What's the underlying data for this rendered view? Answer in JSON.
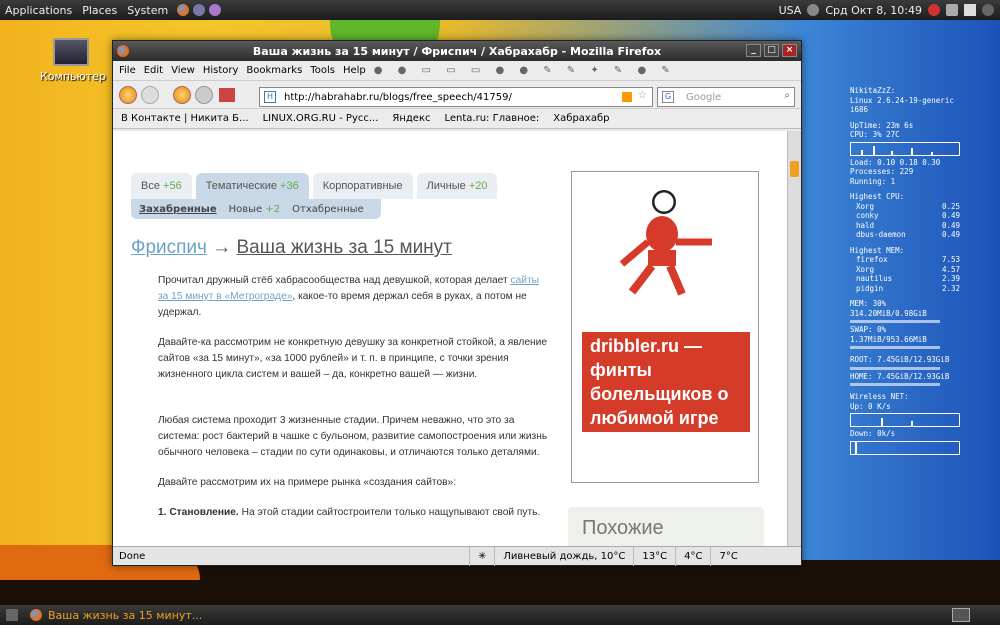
{
  "topbar": {
    "menus": [
      "Applications",
      "Places",
      "System"
    ],
    "tray": {
      "kbd": "USA",
      "datetime": "Срд Окт  8, 10:49"
    }
  },
  "desktop": {
    "icon_label": "Компьютер"
  },
  "conky": {
    "host": "NikitaZzZ:",
    "kernel": "Linux 2.6.24-19-generic",
    "arch": "i686",
    "uptime": "UpTime: 23m 6s",
    "cpu": "CPU: 3% 27C",
    "load": "Load: 0.10 0.18 0.30",
    "processes": "Processes: 229",
    "running": "Running: 1",
    "highest_cpu_title": "Highest CPU:",
    "top_cpu": [
      [
        "Xorg",
        "0.25"
      ],
      [
        "conky",
        "0.49"
      ],
      [
        "hald",
        "0.49"
      ],
      [
        "dbus-daemon",
        "0.49"
      ]
    ],
    "highest_mem_title": "Highest MEM:",
    "top_mem": [
      [
        "firefox",
        "7.53"
      ],
      [
        "Xorg",
        "4.57"
      ],
      [
        "nautilus",
        "2.39"
      ],
      [
        "pidgin",
        "2.32"
      ]
    ],
    "mem": "MEM: 30% 314.20MiB/0.98GiB",
    "swap": "SWAP: 0% 1.37MiB/953.66MiB",
    "root": "ROOT: 7.45GiB/12.93GiB",
    "home": "HOME: 7.45GiB/12.93GiB",
    "net_title": "Wireless NET:",
    "up": "Up: 0 K/s",
    "down": "Down: 0k/s"
  },
  "window": {
    "title": "Ваша жизнь за 15 минут / Фриспич / Хабрахабр - Mozilla Firefox",
    "menu": [
      "File",
      "Edit",
      "View",
      "History",
      "Bookmarks",
      "Tools",
      "Help"
    ],
    "url": "http://habrahabr.ru/blogs/free_speech/41759/",
    "search_placeholder": "Google",
    "bookmarks": [
      "В Контакте | Никита Б...",
      "LINUX.ORG.RU - Русс...",
      "Яндекс",
      "Lenta.ru: Главное:",
      "Хабрахабр"
    ],
    "status": {
      "done": "Done",
      "weather": "Ливневый дождь, 10°C",
      "t1": "13°C",
      "t2": "4°C",
      "t3": "7°C"
    }
  },
  "page": {
    "tabs": [
      {
        "label": "Все",
        "count": "+56"
      },
      {
        "label": "Тематические",
        "count": "+36"
      },
      {
        "label": "Корпоративные",
        "count": ""
      },
      {
        "label": "Личные",
        "count": "+20"
      }
    ],
    "subtabs": {
      "a": "Захабренные",
      "b": "Новые",
      "b_count": "+2",
      "c": "Отхабренные"
    },
    "blog": "Фриспич",
    "arrow": "→",
    "title": "Ваша жизнь за 15 минут",
    "p1a": "Прочитал дружный стёб хабрасообщества над девушкой, которая делает ",
    "p1link": "сайты за 15 минут в «Метрограде»",
    "p1b": ", какое-то время держал себя в руках, а потом не удержал.",
    "p2": "Давайте-ка рассмотрим не конкретную девушку за конкретной стойкой, а явление сайтов «за 15 минут», «за 1000 рублей» и т. п. в принципе, с точки зрения жизненного цикла систем и вашей – да, конкретно вашей — жизни.",
    "p3": "Любая система проходит 3 жизненные стадии. Причем неважно, что это за система: рост бактерий в чашке с бульоном, развитие самопостроения или жизнь обычного человека – стадии по сути одинаковы, и отличаются только деталями.",
    "p4": "Давайте рассмотрим их на примере рынка «создания сайтов»:",
    "p5b": "1. Становление.",
    "p5": " На этой стадии сайтостроители только нащупывают свой путь.",
    "ad": "dribbler.ru — финты болельщиков о любимой игре",
    "similar": "Похожие"
  },
  "taskbar": {
    "item": "Ваша жизнь за 15 минут..."
  }
}
